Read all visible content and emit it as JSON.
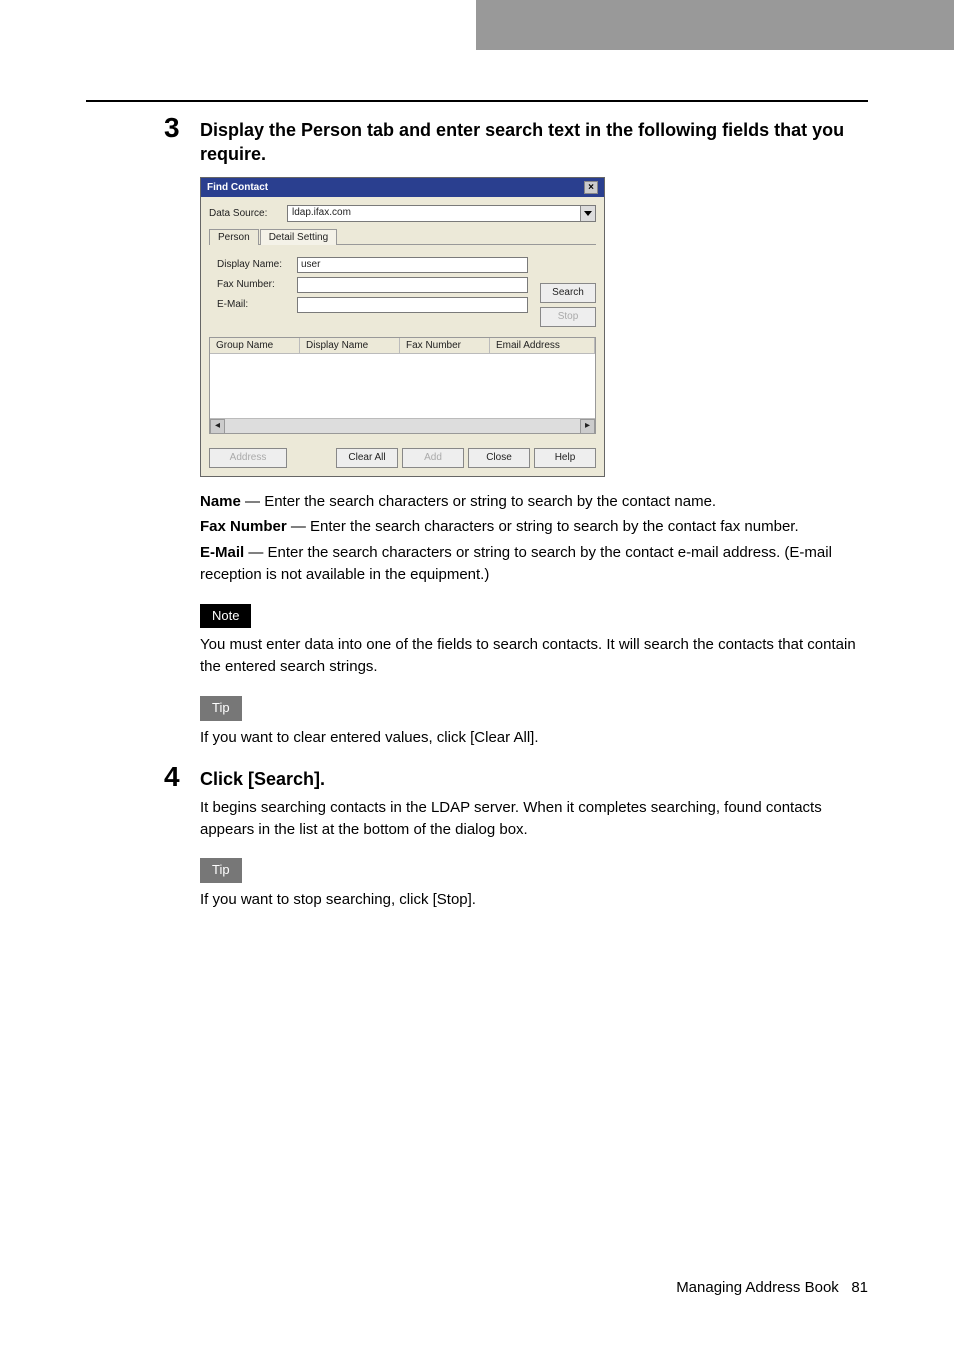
{
  "step3": {
    "num": "3",
    "title": "Display the Person tab and enter search text in the following fields that you require.",
    "name_label": "Name",
    "name_desc": " — Enter the search characters or string to search by the contact name.",
    "fax_label": "Fax Number",
    "fax_desc": " — Enter the search characters or string to search by the contact fax number.",
    "email_label": "E-Mail",
    "email_desc": " — Enter the search characters or string to search by the contact e-mail address. (E-mail reception is not available in the equipment.)",
    "note_tag": "Note",
    "note_text": "You must enter data into one of the fields to search contacts. It will search the contacts that contain the entered search strings.",
    "tip_tag": "Tip",
    "tip_text": "If you want to clear entered values, click [Clear All]."
  },
  "step4": {
    "num": "4",
    "title": "Click [Search].",
    "body": "It begins searching contacts in the LDAP server. When it completes searching, found contacts appears in the list at the bottom of the dialog box.",
    "tip_tag": "Tip",
    "tip_text": "If you want to stop searching, click [Stop]."
  },
  "dialog": {
    "title": "Find Contact",
    "close_x": "×",
    "data_source_label": "Data Source:",
    "data_source_value": "ldap.ifax.com",
    "tabs": {
      "person": "Person",
      "detail": "Detail Setting"
    },
    "fields": {
      "display_name_label": "Display Name:",
      "display_name_value": "user",
      "fax_label": "Fax Number:",
      "fax_value": "",
      "email_label": "E-Mail:",
      "email_value": ""
    },
    "buttons": {
      "search": "Search",
      "stop": "Stop",
      "address": "Address",
      "clear_all": "Clear All",
      "add": "Add",
      "close": "Close",
      "help": "Help"
    },
    "grid": {
      "group_name": "Group Name",
      "display_name": "Display Name",
      "fax_number": "Fax Number",
      "email": "Email Address"
    },
    "scroll": {
      "left": "◂",
      "right": "▸"
    }
  },
  "footer": {
    "text": "Managing Address Book",
    "page": "81"
  }
}
